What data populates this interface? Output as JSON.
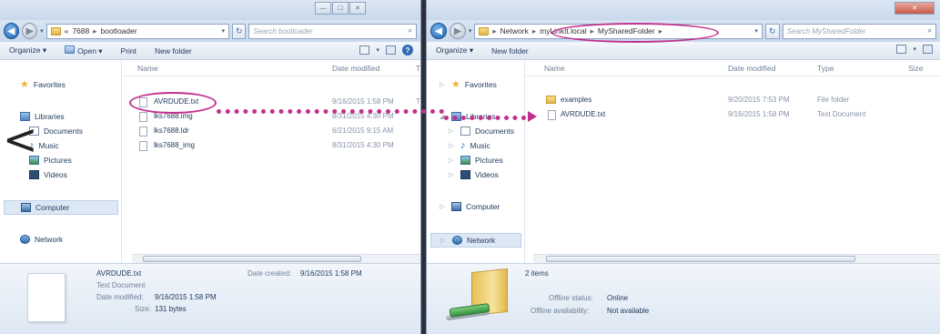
{
  "left": {
    "address": {
      "crumb_prefix": "«",
      "crumb1": "7688",
      "crumb2": "bootloader"
    },
    "search_placeholder": "Search bootloader",
    "toolbar": {
      "organize": "Organize ▾",
      "open": "Open ▾",
      "print": "Print",
      "new_folder": "New folder"
    },
    "nav": [
      {
        "label": "Favorites",
        "icon": "star-icon"
      },
      {
        "label": "Libraries",
        "icon": "library-icon"
      },
      {
        "label": "Documents",
        "icon": "documents-icon"
      },
      {
        "label": "Music",
        "icon": "music-icon"
      },
      {
        "label": "Pictures",
        "icon": "pictures-icon"
      },
      {
        "label": "Videos",
        "icon": "videos-icon"
      },
      {
        "label": "Computer",
        "icon": "computer-icon"
      },
      {
        "label": "Network",
        "icon": "network-icon"
      }
    ],
    "columns": {
      "name": "Name",
      "date": "Date modified",
      "type": "T"
    },
    "files": [
      {
        "name": "AVRDUDE.txt",
        "date": "9/16/2015 1:58 PM",
        "type": "T"
      },
      {
        "name": "lks7688.img",
        "date": "8/31/2015 4:30 PM",
        "type": ""
      },
      {
        "name": "lks7688.ldr",
        "date": "6/21/2015 9:15 AM",
        "type": ""
      },
      {
        "name": "lks7688_img",
        "date": "8/31/2015 4:30 PM",
        "type": ""
      }
    ],
    "details": {
      "filename": "AVRDUDE.txt",
      "filetype": "Text Document",
      "modified_label": "Date modified:",
      "modified_value": "9/16/2015 1:58 PM",
      "size_label": "Size:",
      "size_value": "131 bytes",
      "created_label": "Date created:",
      "created_value": "9/16/2015 1:58 PM"
    }
  },
  "right": {
    "address": {
      "crumb1": "Network",
      "crumb2": "myLinkIt.local",
      "crumb3": "MySharedFolder"
    },
    "search_placeholder": "Search MySharedFolder",
    "toolbar": {
      "organize": "Organize ▾",
      "new_folder": "New folder"
    },
    "nav": [
      {
        "label": "Favorites",
        "icon": "star-icon"
      },
      {
        "label": "Libraries",
        "icon": "library-icon"
      },
      {
        "label": "Documents",
        "icon": "documents-icon"
      },
      {
        "label": "Music",
        "icon": "music-icon"
      },
      {
        "label": "Pictures",
        "icon": "pictures-icon"
      },
      {
        "label": "Videos",
        "icon": "videos-icon"
      },
      {
        "label": "Computer",
        "icon": "computer-icon"
      },
      {
        "label": "Network",
        "icon": "network-icon"
      }
    ],
    "columns": {
      "name": "Name",
      "date": "Date modified",
      "type": "Type",
      "size": "Size"
    },
    "files": [
      {
        "name": "examples",
        "date": "9/20/2015 7:53 PM",
        "type": "File folder"
      },
      {
        "name": "AVRDUDE.txt",
        "date": "9/16/2015 1:58 PM",
        "type": "Text Document"
      }
    ],
    "details": {
      "count": "2 items",
      "offline_status_label": "Offline status:",
      "offline_status_value": "Online",
      "offline_avail_label": "Offline availability:",
      "offline_avail_value": "Not available"
    }
  },
  "annotation_color": "#c2308f"
}
